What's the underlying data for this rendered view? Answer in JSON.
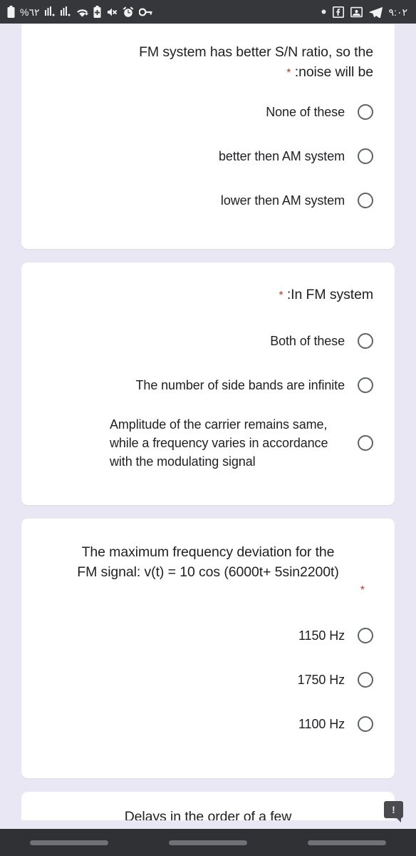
{
  "status_bar": {
    "battery_percent": "%٦٢",
    "time": "٩:٠٢",
    "left_icons": [
      "battery-icon",
      "signal-bars-icon",
      "signal-bars-2-icon",
      "wifi-icon",
      "battery-saver-icon",
      "mute-icon",
      "alarm-icon",
      "vpn-key-icon"
    ],
    "right_icons": [
      "dot-icon",
      "facebook-icon",
      "photo-icon",
      "telegram-icon"
    ]
  },
  "theme": {
    "background": "#eae7f4",
    "card_background": "#ffffff",
    "text_color": "#202124",
    "required_color": "#c0392b",
    "radio_border": "#5f6368",
    "status_bar_background": "#36373b",
    "nav_bar_background": "#303135"
  },
  "questions": [
    {
      "title": "FM system has better S/N ratio, so the :noise will be",
      "title_line_1": "FM system has better S/N ratio, so the",
      "title_line_2": ":noise will be",
      "required_marker": "*",
      "options": [
        {
          "label": "None of these",
          "selected": false
        },
        {
          "label": "better then AM system",
          "selected": false
        },
        {
          "label": "lower then AM system",
          "selected": false
        }
      ]
    },
    {
      "title": ":In FM system",
      "required_marker": "*",
      "options": [
        {
          "label": "Both of these",
          "selected": false
        },
        {
          "label": "The number of side bands are infinite",
          "selected": false
        },
        {
          "label": "Amplitude of the carrier remains same, while a frequency varies in accordance with the modulating signal",
          "selected": false
        }
      ]
    },
    {
      "title": "The maximum frequency deviation for the FM signal: v(t) = 10 cos (6000t+ 5sin2200t)",
      "title_line_1": "The maximum frequency deviation for the",
      "title_line_2": "FM signal: v(t) = 10 cos (6000t+ 5sin2200t)",
      "required_marker": "*",
      "options": [
        {
          "label": "1150 Hz",
          "selected": false
        },
        {
          "label": "1750 Hz",
          "selected": false
        },
        {
          "label": "1100 Hz",
          "selected": false
        }
      ]
    }
  ],
  "next_card": {
    "partial_text": "Delays in the order of a few"
  },
  "tooltip": {
    "icon": "exclamation-icon",
    "label": "!"
  },
  "nav_bar": {
    "buttons": [
      "recents-button",
      "home-button",
      "back-button"
    ]
  }
}
